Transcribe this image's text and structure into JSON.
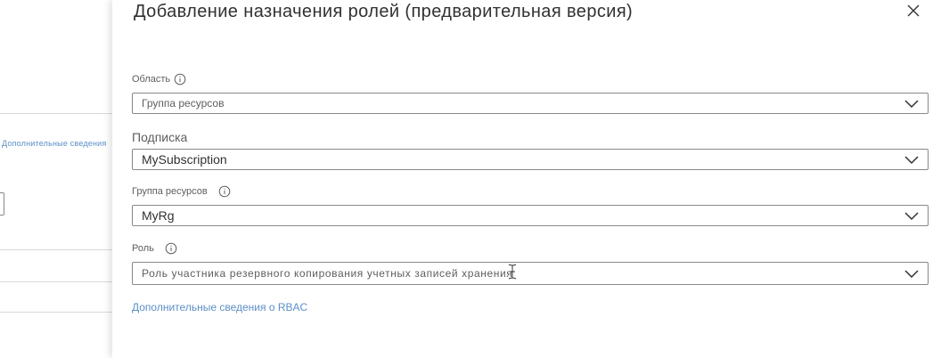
{
  "background": {
    "link": "Дополнительные сведения"
  },
  "panel": {
    "title": "Добавление назначения ролей (предварительная версия)",
    "close_icon": "close-icon",
    "fields": {
      "scope": {
        "label": "Область",
        "value": "Группа ресурсов"
      },
      "subscription": {
        "label": "Подписка",
        "value": "MySubscription"
      },
      "resource_group": {
        "label": "Группа ресурсов",
        "value": "MyRg"
      },
      "role": {
        "label": "Роль",
        "value": "Роль участника резервного копирования учетных записей хранения"
      }
    },
    "rbac_link": "Дополнительные сведения о RBAC"
  },
  "colors": {
    "link": "#5c8fc7",
    "border": "#8a8886",
    "text": "#323130"
  }
}
